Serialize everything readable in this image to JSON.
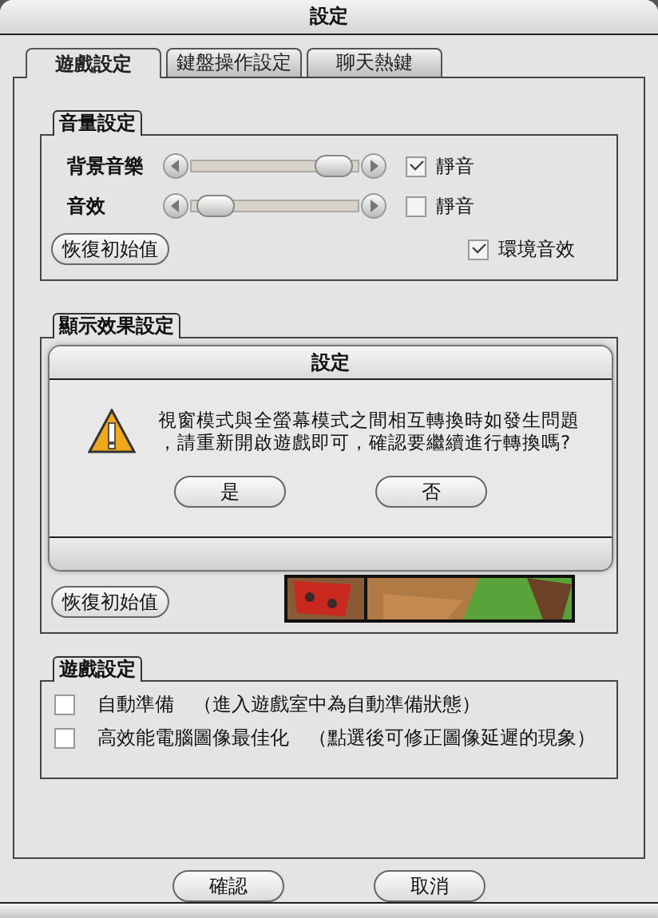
{
  "window": {
    "title": "設定"
  },
  "tabs": [
    {
      "label": "遊戲設定",
      "selected": true
    },
    {
      "label": "鍵盤操作設定",
      "selected": false
    },
    {
      "label": "聊天熱鍵",
      "selected": false
    }
  ],
  "audio_group": {
    "title": "音量設定",
    "sliders": [
      {
        "label": "背景音樂",
        "level": 0.95,
        "mute_label": "靜音",
        "muted": true
      },
      {
        "label": "音效",
        "level": 0.05,
        "mute_label": "靜音",
        "muted": false
      }
    ],
    "ambient": {
      "label": "環境音效",
      "checked": true
    },
    "reset_button": "恢復初始值"
  },
  "display_group": {
    "title": "顯示效果設定",
    "reset_button": "恢復初始值"
  },
  "game_group": {
    "title": "遊戲設定",
    "options": [
      {
        "label": "自動準備",
        "note": "（進入遊戲室中為自動準備狀態）",
        "checked": false
      },
      {
        "label": "高效能電腦圖像最佳化",
        "note": "（點選後可修正圖像延遲的現象）",
        "checked": false
      }
    ]
  },
  "buttons": [
    "確認",
    "取消"
  ],
  "dialog": {
    "title": "設定",
    "message_lines": [
      "視窗模式與全螢幕模式之間相互轉換時如發生問題",
      "，請重新開啟遊戲即可，確認要繼續進行轉換嗎?"
    ],
    "buttons": [
      "是",
      "否"
    ]
  }
}
